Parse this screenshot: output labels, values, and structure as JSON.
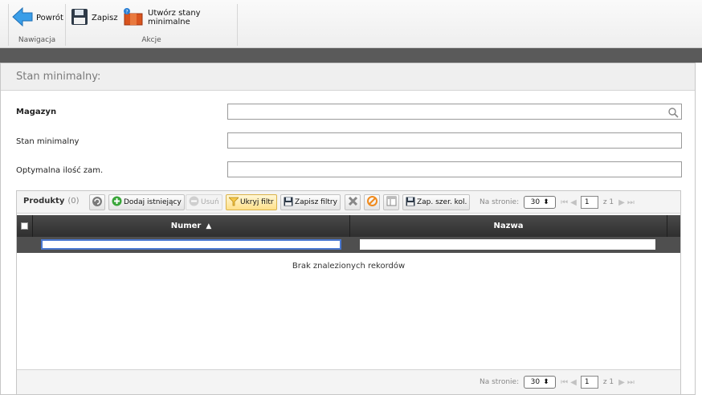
{
  "ribbon": {
    "back_label": "Powrót",
    "save_label": "Zapisz",
    "create_min_label": "Utwórz stany minimalne",
    "nav_group_label": "Nawigacja",
    "actions_group_label": "Akcje"
  },
  "panel": {
    "title": "Stan minimalny:"
  },
  "form": {
    "warehouse_label": "Magazyn",
    "warehouse_value": "",
    "min_stock_label": "Stan minimalny",
    "min_stock_value": "",
    "optimal_qty_label": "Optymalna ilość zam.",
    "optimal_qty_value": ""
  },
  "grid": {
    "title": "Produkty",
    "count": "(0)",
    "add_existing_label": "Dodaj istniejący",
    "remove_label": "Usuń",
    "hide_filter_label": "Ukryj filtr",
    "save_filters_label": "Zapisz filtry",
    "save_col_widths_label": "Zap. szer. kol.",
    "per_page_label": "Na stronie:",
    "per_page_value": "30",
    "page_value": "1",
    "page_of": "z 1",
    "columns": [
      {
        "label": "Numer",
        "sort": "asc"
      },
      {
        "label": "Nazwa"
      }
    ],
    "empty_message": "Brak znalezionych rekordów"
  },
  "colors": {
    "accent": "#4a78d0",
    "header_dark": "#333333"
  }
}
